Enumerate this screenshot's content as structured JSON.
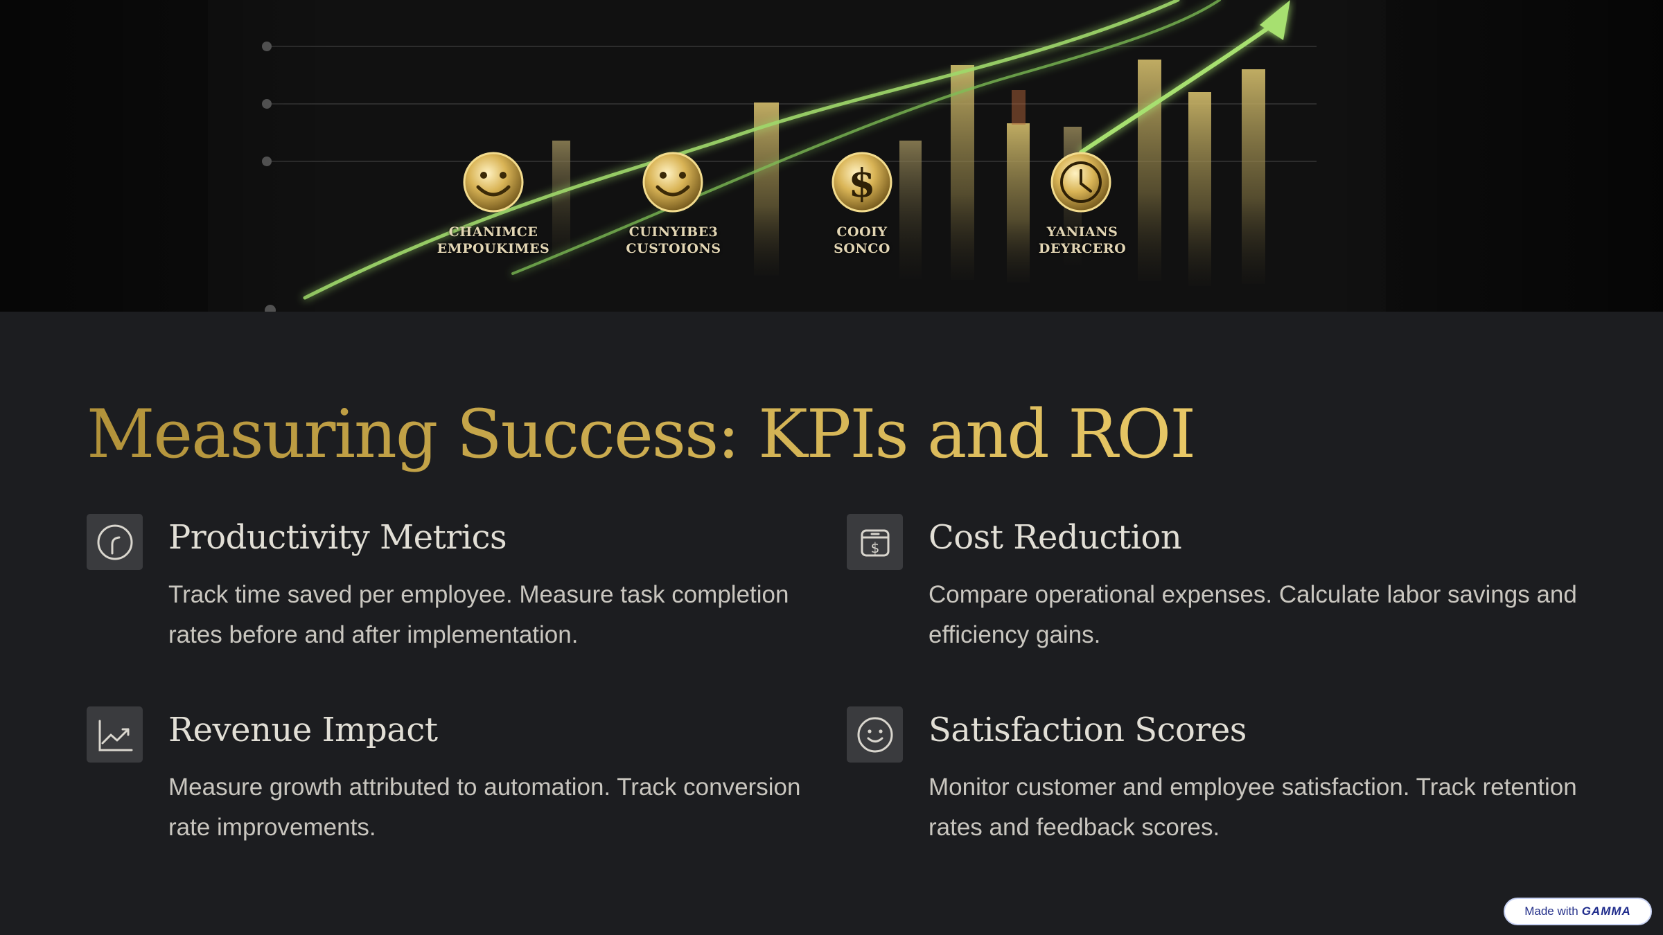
{
  "hero": {
    "badges": [
      {
        "icon": "smiley-icon",
        "line1": "CHANIMCE",
        "line2": "EMPOUKIMES"
      },
      {
        "icon": "smiley-icon",
        "line1": "CUINYIBE3",
        "line2": "CUSTOIONS"
      },
      {
        "icon": "dollar-coin-icon",
        "line1": "COOIY",
        "line2": "SONCO"
      },
      {
        "icon": "clock-icon",
        "line1": "YANIANS",
        "line2": "DEYRCERO"
      }
    ]
  },
  "title": "Measuring Success: KPIs and ROI",
  "kpis": [
    {
      "icon": "gauge-icon",
      "title": "Productivity Metrics",
      "description": "Track time saved per employee. Measure task completion rates before and after implementation."
    },
    {
      "icon": "money-box-icon",
      "title": "Cost Reduction",
      "description": "Compare operational expenses. Calculate labor savings and efficiency gains."
    },
    {
      "icon": "trend-chart-icon",
      "title": "Revenue Impact",
      "description": "Measure growth attributed to automation. Track conversion rate improvements."
    },
    {
      "icon": "smiley-icon",
      "title": "Satisfaction Scores",
      "description": "Monitor customer and employee satisfaction. Track retention rates and feedback scores."
    }
  ],
  "badge": {
    "prefix": "Made with",
    "brand": "GAMMA"
  },
  "colors": {
    "background": "#1c1d20",
    "title_gradient_start": "#b2923a",
    "title_gradient_end": "#e8c866",
    "heading": "#e2dfd6",
    "body": "#c9c6bf",
    "icon_tile": "#3a3b3e",
    "trend_green": "#9fd86a"
  }
}
